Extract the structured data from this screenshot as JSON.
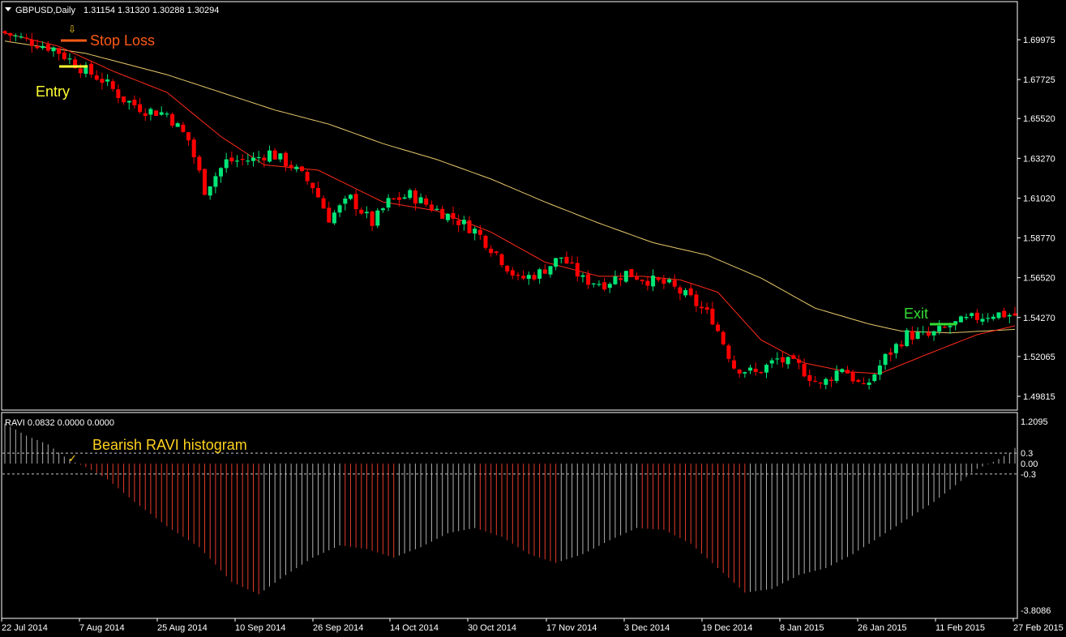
{
  "header": {
    "symbol_label": "GBPUSD,Daily",
    "ohlc": "1.31154 1.31320 1.30288 1.30294"
  },
  "colors": {
    "background": "#000000",
    "frame": "#ffffff",
    "bull": "#00e676",
    "bear": "#ff0000",
    "ema_fast": "#ff2a1a",
    "ema_slow": "#e8c86a",
    "hist_neg": "#e23a2a",
    "hist_pos": "#b0b0b0",
    "annotation_orange": "#ff5a14",
    "annotation_yellow": "#ffff33",
    "annotation_gold": "#ffd21e",
    "annotation_green": "#33dd33",
    "level_line": "#c8c8c8"
  },
  "annotations": {
    "stop_loss": "Stop Loss",
    "entry": "Entry",
    "exit": "Exit",
    "histogram": "Bearish RAVI histogram",
    "arrow_icon": "⇩",
    "check_icon": "✓"
  },
  "chart_data": [
    {
      "type": "candlestick",
      "y_tick_labels": [
        "1.69975",
        "1.67725",
        "1.65520",
        "1.63270",
        "1.61020",
        "1.58770",
        "1.56520",
        "1.54270",
        "1.52065",
        "1.49815"
      ],
      "y_ticks": [
        1.69975,
        1.67725,
        1.6552,
        1.6327,
        1.6102,
        1.5877,
        1.5652,
        1.5427,
        1.52065,
        1.49815
      ],
      "ylim": [
        1.4925,
        1.7195
      ],
      "x_tick_labels": [
        "22 Jul 2014",
        "7 Aug 2014",
        "25 Aug 2014",
        "10 Sep 2014",
        "26 Sep 2014",
        "14 Oct 2014",
        "30 Oct 2014",
        "17 Nov 2014",
        "3 Dec 2014",
        "19 Dec 2014",
        "8 Jan 2015",
        "26 Jan 2015",
        "11 Feb 2015",
        "27 Feb 2015"
      ],
      "close_path": [
        [
          0,
          1.7035
        ],
        [
          5,
          1.6985
        ],
        [
          9,
          1.695
        ],
        [
          14,
          1.684
        ],
        [
          18,
          1.677
        ],
        [
          22,
          1.666
        ],
        [
          26,
          1.66
        ],
        [
          30,
          1.658
        ],
        [
          34,
          1.643
        ],
        [
          37,
          1.615
        ],
        [
          41,
          1.631
        ],
        [
          46,
          1.632
        ],
        [
          49,
          1.636
        ],
        [
          53,
          1.6285
        ],
        [
          57,
          1.617
        ],
        [
          60,
          1.599
        ],
        [
          64,
          1.61
        ],
        [
          68,
          1.596
        ],
        [
          71,
          1.608
        ],
        [
          75,
          1.612
        ],
        [
          79,
          1.605
        ],
        [
          83,
          1.599
        ],
        [
          87,
          1.592
        ],
        [
          91,
          1.579
        ],
        [
          95,
          1.564
        ],
        [
          99,
          1.568
        ],
        [
          103,
          1.577
        ],
        [
          107,
          1.564
        ],
        [
          111,
          1.562
        ],
        [
          115,
          1.568
        ],
        [
          119,
          1.564
        ],
        [
          123,
          1.561
        ],
        [
          127,
          1.553
        ],
        [
          131,
          1.542
        ],
        [
          135,
          1.515
        ],
        [
          139,
          1.511
        ],
        [
          143,
          1.519
        ],
        [
          147,
          1.515
        ],
        [
          151,
          1.504
        ],
        [
          155,
          1.515
        ],
        [
          159,
          1.502
        ],
        [
          163,
          1.52
        ],
        [
          167,
          1.533
        ],
        [
          171,
          1.532
        ],
        [
          175,
          1.538
        ],
        [
          179,
          1.542
        ],
        [
          183,
          1.545
        ],
        [
          187,
          1.544
        ]
      ],
      "ema_fast": [
        [
          0,
          1.7035
        ],
        [
          10,
          1.696
        ],
        [
          20,
          1.682
        ],
        [
          30,
          1.67
        ],
        [
          40,
          1.645
        ],
        [
          48,
          1.629
        ],
        [
          58,
          1.626
        ],
        [
          70,
          1.608
        ],
        [
          80,
          1.603
        ],
        [
          90,
          1.591
        ],
        [
          100,
          1.574
        ],
        [
          110,
          1.566
        ],
        [
          118,
          1.566
        ],
        [
          125,
          1.564
        ],
        [
          132,
          1.557
        ],
        [
          140,
          1.53
        ],
        [
          148,
          1.517
        ],
        [
          156,
          1.512
        ],
        [
          162,
          1.511
        ],
        [
          170,
          1.521
        ],
        [
          180,
          1.533
        ],
        [
          187,
          1.538
        ]
      ],
      "ema_slow": [
        [
          0,
          1.699
        ],
        [
          15,
          1.692
        ],
        [
          30,
          1.68
        ],
        [
          40,
          1.67
        ],
        [
          50,
          1.66
        ],
        [
          60,
          1.652
        ],
        [
          70,
          1.641
        ],
        [
          80,
          1.632
        ],
        [
          90,
          1.621
        ],
        [
          100,
          1.608
        ],
        [
          110,
          1.596
        ],
        [
          120,
          1.585
        ],
        [
          130,
          1.578
        ],
        [
          140,
          1.565
        ],
        [
          150,
          1.548
        ],
        [
          160,
          1.539
        ],
        [
          166,
          1.535
        ],
        [
          175,
          1.534
        ],
        [
          187,
          1.536
        ]
      ],
      "stop_loss_price": 1.7,
      "entry_price": 1.6855,
      "exit_price": 1.538
    },
    {
      "type": "histogram",
      "indicator_label": "RAVI 0.0832 0.0000 0.0000",
      "y_tick_labels": [
        "1.2095",
        "0.3",
        "0.00",
        "-0.3",
        "-3.8086"
      ],
      "y_ticks": [
        1.2095,
        0.3,
        0.0,
        -0.3,
        -3.8086
      ],
      "levels": [
        0.3,
        -0.3
      ],
      "ylim": [
        -3.82,
        1.22
      ],
      "envelope": [
        [
          0,
          1.15
        ],
        [
          4,
          0.8
        ],
        [
          8,
          0.55
        ],
        [
          11,
          0.2
        ],
        [
          13,
          0.03
        ],
        [
          15,
          -0.1
        ],
        [
          19,
          -0.45
        ],
        [
          24,
          -1.1
        ],
        [
          30,
          -1.8
        ],
        [
          36,
          -2.4
        ],
        [
          42,
          -3.4
        ],
        [
          47,
          -3.75
        ],
        [
          52,
          -3.2
        ],
        [
          57,
          -2.7
        ],
        [
          62,
          -2.35
        ],
        [
          67,
          -2.45
        ],
        [
          72,
          -2.7
        ],
        [
          77,
          -2.4
        ],
        [
          82,
          -2.0
        ],
        [
          87,
          -1.85
        ],
        [
          92,
          -2.1
        ],
        [
          97,
          -2.6
        ],
        [
          102,
          -2.85
        ],
        [
          107,
          -2.6
        ],
        [
          112,
          -2.2
        ],
        [
          117,
          -1.85
        ],
        [
          122,
          -1.9
        ],
        [
          127,
          -2.3
        ],
        [
          132,
          -3.0
        ],
        [
          137,
          -3.7
        ],
        [
          142,
          -3.6
        ],
        [
          147,
          -3.2
        ],
        [
          152,
          -3.0
        ],
        [
          157,
          -2.6
        ],
        [
          162,
          -2.1
        ],
        [
          167,
          -1.6
        ],
        [
          172,
          -1.1
        ],
        [
          177,
          -0.5
        ],
        [
          180,
          -0.15
        ],
        [
          183,
          0.05
        ],
        [
          186,
          0.3
        ],
        [
          187,
          0.45
        ]
      ]
    }
  ]
}
